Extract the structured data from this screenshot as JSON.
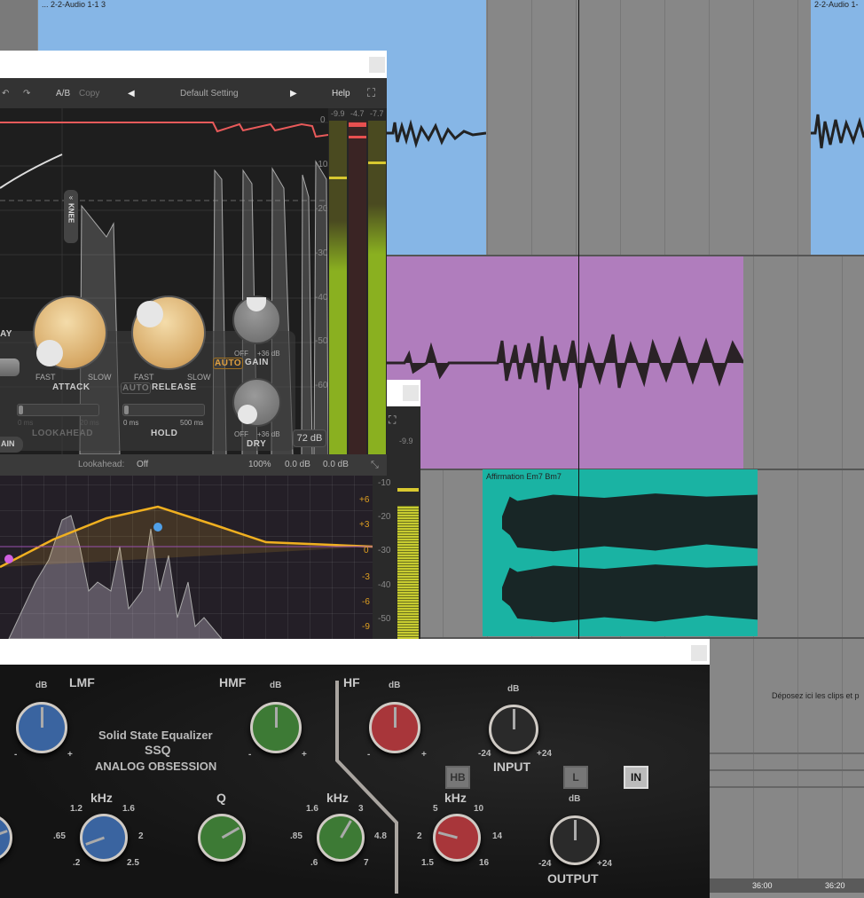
{
  "daw": {
    "clips": [
      {
        "name": "... 2-2-Audio 1-1 3",
        "color": "#86b6e6"
      },
      {
        "name": "2-2-Audio 1-",
        "color": "#86b6e6"
      },
      {
        "name": "",
        "color": "#b07dbd"
      },
      {
        "name": "Affirmation Em7 Bm7",
        "color": "#1ab3a3"
      }
    ],
    "drop_zone_text": "Déposez ici les clips et p",
    "ruler": [
      "36:00",
      "36:20"
    ]
  },
  "compressor": {
    "toolbar": {
      "undo": "↶",
      "redo": "↷",
      "ab": "A/B",
      "copy": "Copy",
      "prev": "◀",
      "preset": "Default Setting",
      "next": "▶",
      "help": "Help",
      "fullscreen": "⛶"
    },
    "db_scale": [
      "0",
      "-10",
      "-20",
      "-30",
      "-40",
      "-50",
      "-60"
    ],
    "meter_readouts": [
      "-9.9",
      "-4.7",
      "-7.7"
    ],
    "knee_label": "KNEE",
    "knobs": {
      "attack": {
        "label": "ATTACK",
        "min": "FAST",
        "max": "SLOW"
      },
      "release": {
        "label": "RELEASE",
        "auto": "AUTO",
        "min": "FAST",
        "max": "SLOW"
      },
      "gain": {
        "label": "GAIN",
        "auto": "AUTO",
        "min": "OFF",
        "max": "+36 dB"
      },
      "dry": {
        "label": "DRY",
        "min": "OFF",
        "max": "+36 dB"
      }
    },
    "sliders": {
      "lookahead": {
        "label": "LOOKAHEAD",
        "min": "0 ms",
        "max": "20 ms"
      },
      "hold": {
        "label": "HOLD",
        "min": "0 ms",
        "max": "500 ms"
      }
    },
    "left_labels": {
      "ay": "AY",
      "gain_btn": "AIN"
    },
    "range_button": "72 dB",
    "footer": {
      "lookahead_label": "Lookahead:",
      "lookahead_value": "Off",
      "mix": "100%",
      "in_gain": "0.0 dB",
      "out_gain": "0.0 dB"
    }
  },
  "eq": {
    "gain_scale": [
      "+6",
      "+3",
      "0",
      "-3",
      "-6",
      "-9"
    ],
    "level_scale": [
      "-10",
      "-20",
      "-30",
      "-40",
      "-50"
    ],
    "meter_readout": "-9.9",
    "band_colors": {
      "curve": "#f0b020",
      "band1": "#d060e0",
      "band2": "#50a0e8"
    }
  },
  "ssq": {
    "title_line1": "Solid State Equalizer",
    "title_line2": "SSQ",
    "title_line3": "ANALOG OBSESSION",
    "sections": {
      "lmf": "LMF",
      "hmf": "HMF",
      "hf": "HF"
    },
    "db": "dB",
    "khz": "kHz",
    "q": "Q",
    "minus": "-",
    "plus": "+",
    "lmf_freq_ticks": [
      "1.2",
      "1.6",
      ".65",
      "2",
      ".2",
      "2.5"
    ],
    "hmf_freq_ticks": [
      "1.6",
      "3",
      ".85",
      "4.8",
      ".6",
      "7"
    ],
    "hf_freq_ticks": [
      "5",
      "10",
      "2",
      "14",
      "1.5",
      "16"
    ],
    "input": {
      "label": "INPUT",
      "min": "-24",
      "max": "+24"
    },
    "output": {
      "label": "OUTPUT",
      "min": "-24",
      "max": "+24"
    },
    "buttons": {
      "hb": "HB",
      "l": "L",
      "in": "IN"
    },
    "colors": {
      "blue": "#3a64a0",
      "green": "#3d7a35",
      "red": "#a8363a",
      "black": "#2a2a2a"
    }
  }
}
